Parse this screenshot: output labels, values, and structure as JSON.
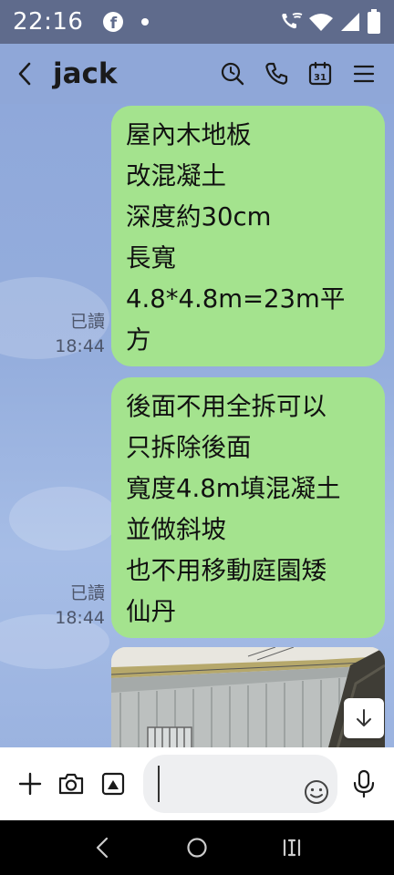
{
  "status_bar": {
    "time": "22:16",
    "icons": [
      "facebook-icon",
      "notification-dot",
      "wifi-call-icon",
      "wifi-icon",
      "signal-icon",
      "battery-icon"
    ]
  },
  "header": {
    "back_icon": "chevron-left-icon",
    "title": "jack",
    "icons": [
      "search-history-icon",
      "phone-icon",
      "calendar-icon",
      "menu-icon"
    ],
    "calendar_day": "31"
  },
  "messages": [
    {
      "lines": [
        "屋內木地板",
        "改混凝土",
        "深度約30cm",
        "長寬",
        "4.8*4.8m=23m平",
        "方"
      ],
      "read": "已讀",
      "time": "18:44"
    },
    {
      "lines": [
        "後面不用全拆可以",
        "只拆除後面",
        "寬度4.8m填混凝土",
        "並做斜坡",
        "也不用移動庭園矮",
        "仙丹"
      ],
      "read": "已讀",
      "time": "18:44"
    }
  ],
  "input_bar": {
    "placeholder": "",
    "icons": [
      "plus-icon",
      "camera-icon",
      "image-icon",
      "emoji-icon",
      "microphone-icon"
    ]
  },
  "colors": {
    "status_bar": "#5f6b8c",
    "chat_background": "#8fa7d8",
    "bubble_sent": "#a4e38e",
    "nav_bar": "#000000"
  }
}
